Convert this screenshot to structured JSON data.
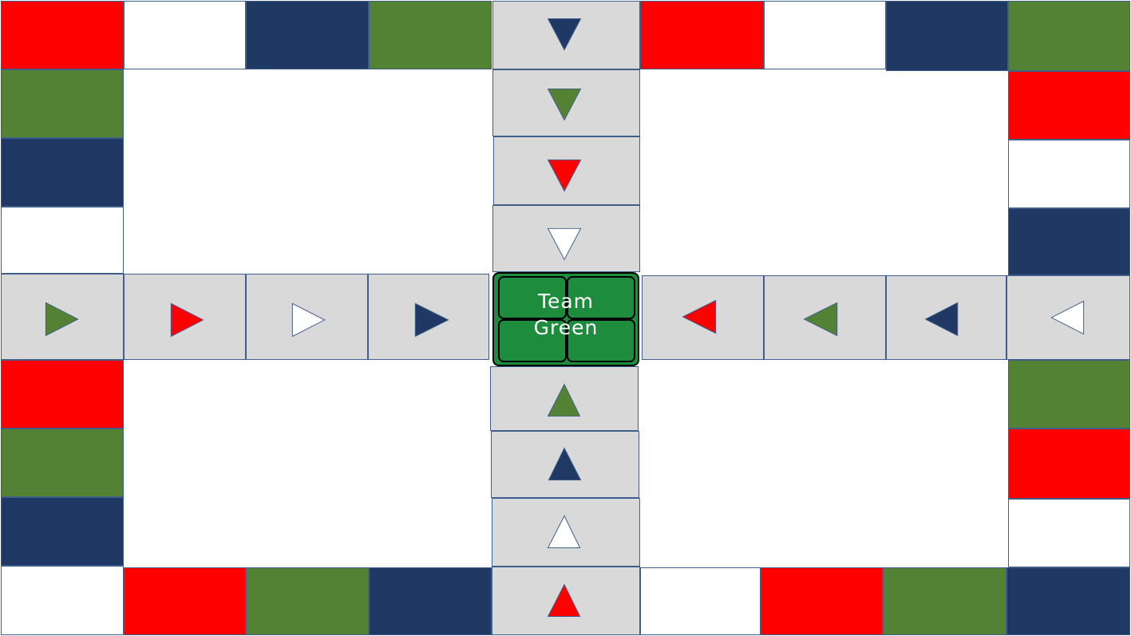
{
  "colors": {
    "red": "#ff0000",
    "white": "#ffffff",
    "navy": "#203864",
    "green": "#548235",
    "lane_bg": "#d9d9d9",
    "home_green": "#1e8c3d"
  },
  "home": {
    "line1": "Team",
    "line2": "Green"
  },
  "track": {
    "top": [
      "red",
      "white",
      "navy",
      "green",
      "lane",
      "red",
      "white",
      "navy",
      "green"
    ],
    "left": [
      "green",
      "navy",
      "white",
      "lane",
      "red",
      "green",
      "navy"
    ],
    "right": [
      "red",
      "white",
      "navy",
      "lane",
      "green",
      "red",
      "white"
    ],
    "bottom": [
      "white",
      "red",
      "green",
      "navy",
      "lane",
      "white",
      "red",
      "green",
      "navy"
    ]
  },
  "lanes": {
    "top_down_arrows": [
      "navy",
      "green",
      "red",
      "white"
    ],
    "left_right_arrows": [
      "green",
      "red",
      "white",
      "navy"
    ],
    "right_left_arrows": [
      "red",
      "green",
      "navy",
      "white"
    ],
    "bottom_up_arrows": [
      "green",
      "navy",
      "white",
      "red"
    ]
  }
}
